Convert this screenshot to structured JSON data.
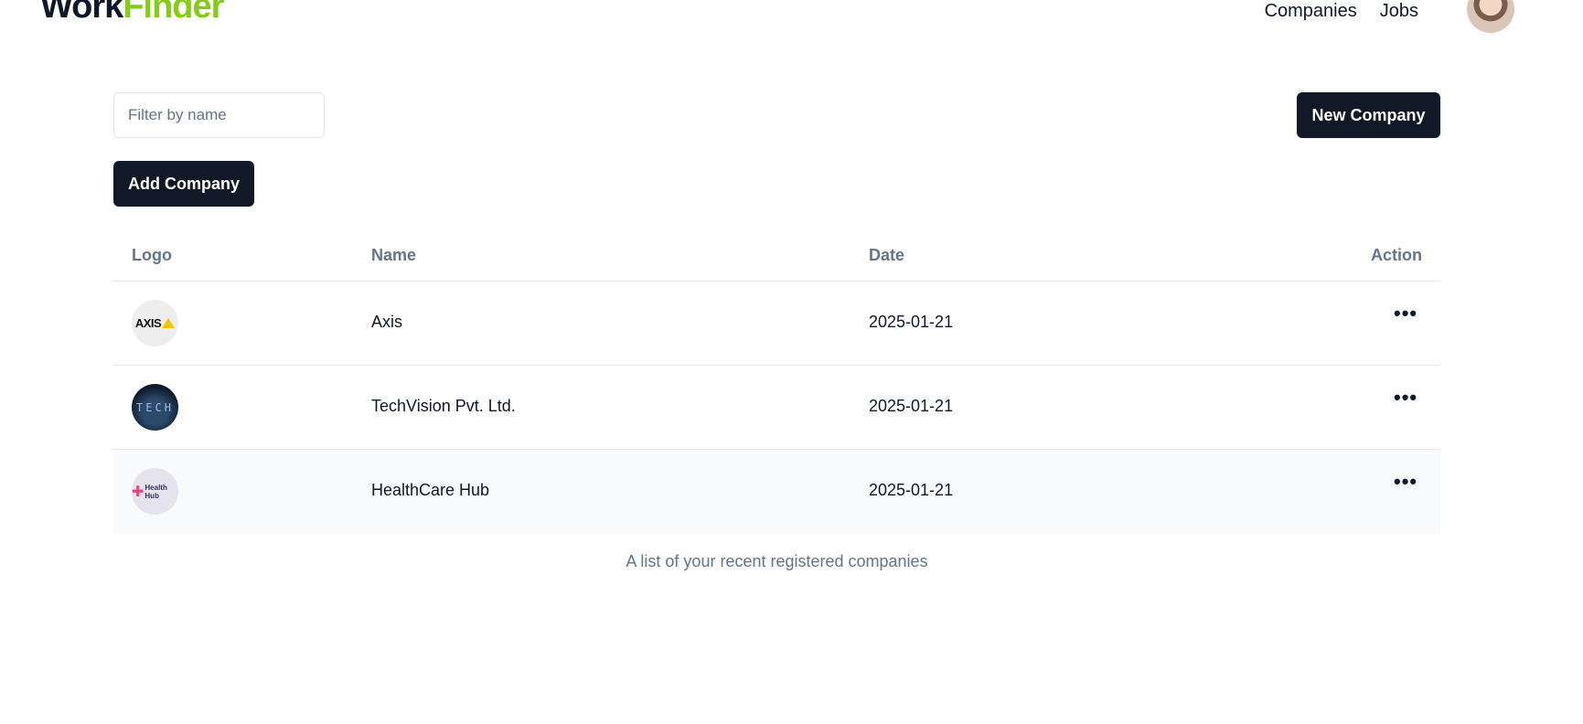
{
  "navbar": {
    "brand_part1": "Work",
    "brand_part2": "Finder",
    "links": [
      "Companies",
      "Jobs"
    ]
  },
  "toolbar": {
    "filter_placeholder": "Filter by name",
    "filter_value": "",
    "new_company_label": "New Company",
    "add_company_label": "Add Company"
  },
  "table": {
    "headers": {
      "logo": "Logo",
      "name": "Name",
      "date": "Date",
      "action": "Action"
    },
    "rows": [
      {
        "logo_icon": "axis-logo",
        "logo_text": "AXIS",
        "name": "Axis",
        "date": "2025-01-21",
        "action": "•••"
      },
      {
        "logo_icon": "techvision-logo",
        "logo_text": "TECH",
        "name": "TechVision Pvt. Ltd.",
        "date": "2025-01-21",
        "action": "•••"
      },
      {
        "logo_icon": "healthcare-hub-logo",
        "logo_text": "Health Hub",
        "name": "HealthCare Hub",
        "date": "2025-01-21",
        "action": "•••"
      }
    ],
    "caption": "A list of your recent registered companies"
  },
  "colors": {
    "brand_dark": "#0f172a",
    "brand_accent": "#84cc16",
    "button_bg": "#111827",
    "muted_text": "#64748b"
  }
}
